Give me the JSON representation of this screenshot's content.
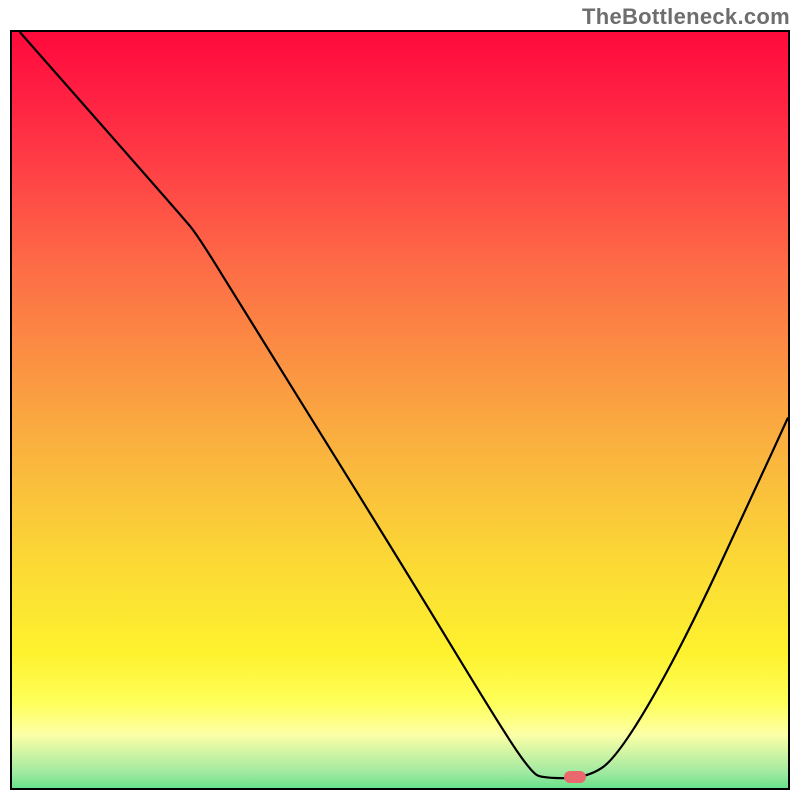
{
  "watermark": "TheBottleneck.com",
  "colors": {
    "curve": "#000000",
    "marker": "#e9686e",
    "border": "#000000"
  },
  "chart_data": {
    "type": "line",
    "title": "",
    "xlabel": "",
    "ylabel": "",
    "xlim": [
      0,
      100
    ],
    "ylim": [
      0,
      100
    ],
    "grid": false,
    "legend": false,
    "background_gradient": {
      "direction": "vertical",
      "stops": [
        {
          "pos": 0.0,
          "color": "#ff0a3c"
        },
        {
          "pos": 0.08,
          "color": "#ff1f42"
        },
        {
          "pos": 0.18,
          "color": "#ff4146"
        },
        {
          "pos": 0.3,
          "color": "#fd6b46"
        },
        {
          "pos": 0.42,
          "color": "#fb9043"
        },
        {
          "pos": 0.55,
          "color": "#fab63e"
        },
        {
          "pos": 0.68,
          "color": "#fbd835"
        },
        {
          "pos": 0.8,
          "color": "#fef22e"
        },
        {
          "pos": 0.865,
          "color": "#feff5a"
        },
        {
          "pos": 0.905,
          "color": "#fdffa6"
        },
        {
          "pos": 0.955,
          "color": "#9fe9a1"
        },
        {
          "pos": 1.0,
          "color": "#1dd66a"
        }
      ]
    },
    "curve_points": [
      {
        "x": 1.0,
        "y": 100.0
      },
      {
        "x": 22.0,
        "y": 75.5
      },
      {
        "x": 24.0,
        "y": 73.0
      },
      {
        "x": 30.0,
        "y": 63.0
      },
      {
        "x": 50.0,
        "y": 30.0
      },
      {
        "x": 63.0,
        "y": 8.0
      },
      {
        "x": 67.0,
        "y": 2.0
      },
      {
        "x": 68.5,
        "y": 1.3
      },
      {
        "x": 74.0,
        "y": 1.3
      },
      {
        "x": 78.0,
        "y": 4.0
      },
      {
        "x": 86.0,
        "y": 18.0
      },
      {
        "x": 96.0,
        "y": 40.0
      },
      {
        "x": 100.0,
        "y": 49.0
      }
    ],
    "marker": {
      "x": 72.5,
      "y": 1.5
    }
  }
}
